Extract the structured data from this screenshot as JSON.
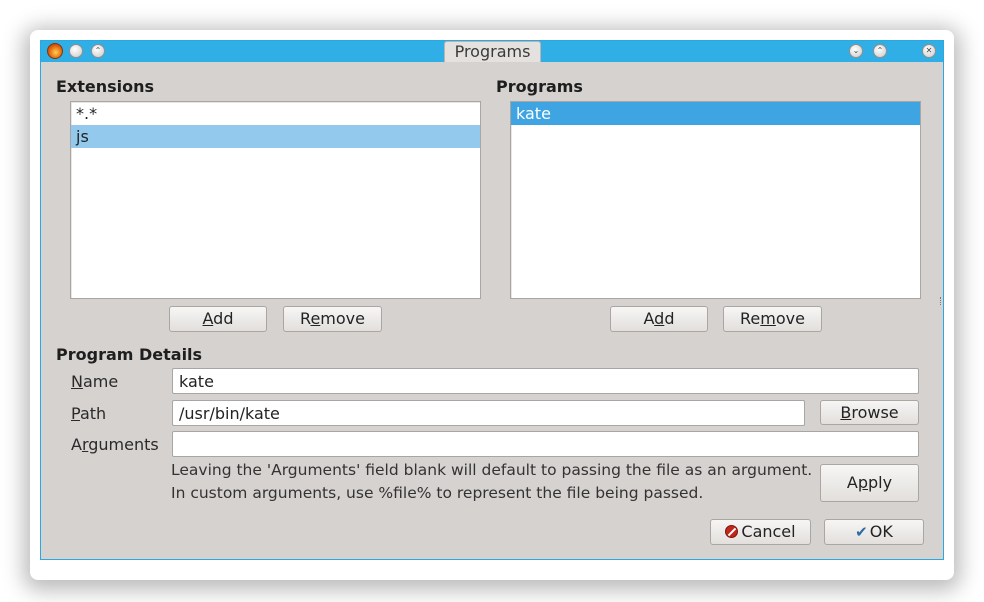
{
  "window": {
    "title": "Programs"
  },
  "titlebar": {
    "buttons": {
      "min": "·",
      "max": "⌃",
      "close": "✕",
      "shade_down": "⌄",
      "shade_up": "⌃"
    }
  },
  "extensions": {
    "label": "Extensions",
    "items": [
      "*.*",
      "js"
    ],
    "selected": "js",
    "add": {
      "accel": "A",
      "rest": "dd"
    },
    "remove": {
      "pre": "R",
      "accel": "e",
      "rest": "move"
    }
  },
  "programs": {
    "label": "Programs",
    "items": [
      "kate"
    ],
    "selected": "kate",
    "add": {
      "pre": "A",
      "accel": "d",
      "rest": "d"
    },
    "remove": {
      "pre": "Re",
      "accel": "m",
      "rest": "ove"
    }
  },
  "details": {
    "label": "Program Details",
    "name": {
      "accel": "N",
      "rest": "ame",
      "value": "kate"
    },
    "path": {
      "accel": "P",
      "rest": "ath",
      "value": "/usr/bin/kate"
    },
    "arguments": {
      "pre": "A",
      "accel": "r",
      "rest": "guments",
      "value": ""
    },
    "browse": {
      "accel": "B",
      "rest": "rowse"
    },
    "apply": {
      "pre": "A",
      "accel": "p",
      "rest": "ply"
    },
    "help_line1": "Leaving the 'Arguments' field blank will default to passing the file as an argument.",
    "help_line2": "In custom arguments, use %file% to represent the file being passed."
  },
  "footer": {
    "cancel": "Cancel",
    "ok": "OK"
  },
  "colors": {
    "titlebar": "#30aee6",
    "window_bg": "#d6d2d0",
    "selection_soft": "#93c9ec",
    "selection_strong": "#3fa4e2"
  }
}
